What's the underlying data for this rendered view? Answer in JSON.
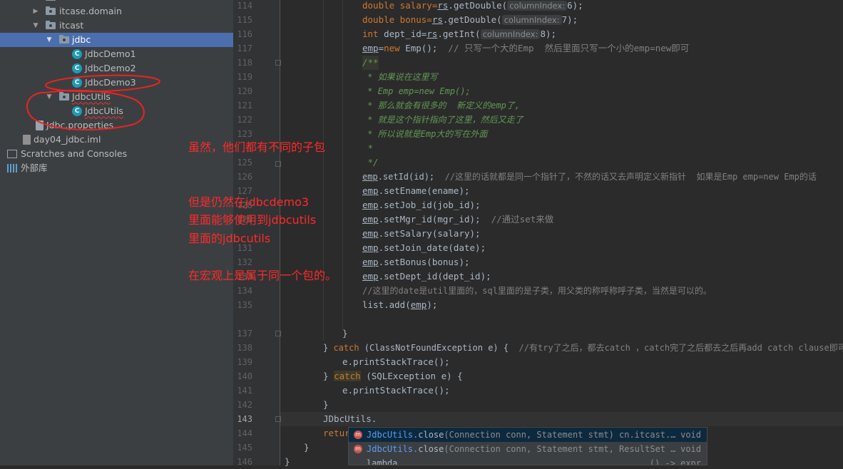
{
  "tree": {
    "items": [
      {
        "label": "itcase.domain",
        "icon": "package-folder-icon"
      },
      {
        "label": "itcast",
        "icon": "package-folder-icon"
      },
      {
        "label": "jdbc",
        "icon": "package-folder-icon"
      },
      {
        "label": "JdbcDemo1",
        "icon": "java-class-icon"
      },
      {
        "label": "JdbcDemo2",
        "icon": "java-class-icon"
      },
      {
        "label": "JdbcDemo3",
        "icon": "java-class-icon"
      },
      {
        "label": "JdbcUtils",
        "icon": "package-folder-icon"
      },
      {
        "label": "JdbcUtils",
        "icon": "java-class-icon"
      },
      {
        "label": "Jdbc.properties",
        "icon": "properties-file-icon"
      },
      {
        "label": "day04_jdbc.iml",
        "icon": "iml-file-icon"
      },
      {
        "label": "Scratches and Consoles",
        "icon": "scratches-icon"
      },
      {
        "label": "外部库",
        "icon": "library-icon"
      }
    ],
    "class_icon_letter": "C"
  },
  "editor": {
    "line_numbers": [
      "114",
      "115",
      "116",
      "117",
      "118",
      "119",
      "120",
      "121",
      "122",
      "123",
      "",
      "125",
      "126",
      "127",
      "128",
      "129",
      "",
      "131",
      "132",
      "133",
      "134",
      "135",
      "",
      "137",
      "138",
      "139",
      "140",
      "141",
      "142",
      "143",
      "144",
      "145",
      "146"
    ],
    "code": {
      "l114a": "double salary=",
      "l114b": "rs",
      "l114c": ".getDouble(",
      "l114hint": "columnIndex:",
      "l114d": "6);",
      "l115a": "double bonus=",
      "l115b": "rs",
      "l115c": ".getDouble(",
      "l115hint": "columnIndex:",
      "l115d": "7);",
      "l116a": "int",
      "l116b": " dept_id=",
      "l116c": "rs",
      "l116d": ".getInt(",
      "l116hint": "columnIndex:",
      "l116e": "8);",
      "l117a": "emp",
      "l117b": "=",
      "l117c": "new",
      "l117d": " Emp();  ",
      "l117e": "// 只写一个大的Emp  然后里面只写一个小的emp=new即可",
      "l118": "/**",
      "l119": " * 如果说在这里写",
      "l120": " * Emp emp=new Emp();",
      "l121": " * 那么就会有很多的  新定义的emp了,",
      "l122": " * 就是这个指针指向了这里，然后又走了",
      "l123": " * 所以说就是Emp大的写在外面",
      "l124": " *",
      "l125": " */",
      "l126a": "emp",
      "l126b": ".setId(id);  ",
      "l126c": "//这里的话就都是同一个指针了，不然的话又去声明定义新指针  如果是Emp emp=new Emp的话",
      "l127a": "emp",
      "l127b": ".setEname(ename);",
      "l128a": "emp",
      "l128b": ".setJob_id(job_id);",
      "l129a": "emp",
      "l129b": ".setMgr_id(mgr_id);  ",
      "l129c": "//通过set来做",
      "l130a": "emp",
      "l130b": ".setSalary(salary);",
      "l131a": "emp",
      "l131b": ".setJoin_date(date);",
      "l132a": "emp",
      "l132b": ".setBonus(bonus);",
      "l133a": "emp",
      "l133b": ".setDept_id(dept_id);",
      "l134": "//这里的date是util里面的，sql里面的是子类，用父类的称呼称呼子类，当然是可以的。",
      "l135a": "list.add(",
      "l135b": "emp",
      "l135c": ");",
      "l137": "}",
      "l138a": "} ",
      "l138b": "catch",
      "l138c": " (ClassNotFoundException e) {  ",
      "l138d": "//有try了之后，都去catch ，catch完了之后都去之后再add catch clause即可",
      "l139": "e.printStackTrace();",
      "l140a": "} ",
      "l140b": "catch",
      "l140c": " (SQLException e) {",
      "l141": "e.printStackTrace();",
      "l142": "}",
      "l143": "JDbcUtils.",
      "l144": "retur",
      "l145": "}",
      "l146": "}"
    }
  },
  "completion": {
    "items": [
      {
        "icon": "m",
        "cls": "JdbcUtils.",
        "method": "close",
        "args": "(Connection conn, Statement stmt) cn.itcast.…",
        "ret": "void"
      },
      {
        "icon": "m",
        "cls": "JdbcUtils.",
        "method": "close",
        "args": "(Connection conn, Statement stmt, ResultSet …",
        "ret": "void"
      },
      {
        "icon": "",
        "cls": "",
        "method": "lambda",
        "args": "",
        "ret": "() -> expr"
      }
    ]
  },
  "annotations": {
    "line1": "虽然，他们都有不同的子包",
    "line2": "但是仍然在jdbcdemo3",
    "line3": "里面能够使用到jdbcutils",
    "line4": "里面的jdbcutils",
    "line5": "在宏观上是属于同一个包的。"
  },
  "colors": {
    "tree_bg": "#3c3f41",
    "selection": "#4b6eaf",
    "editor_bg": "#2b2b2b",
    "keyword": "#cc7832",
    "comment": "#808080",
    "javadoc": "#629755",
    "annotation": "#ff2a2a"
  }
}
